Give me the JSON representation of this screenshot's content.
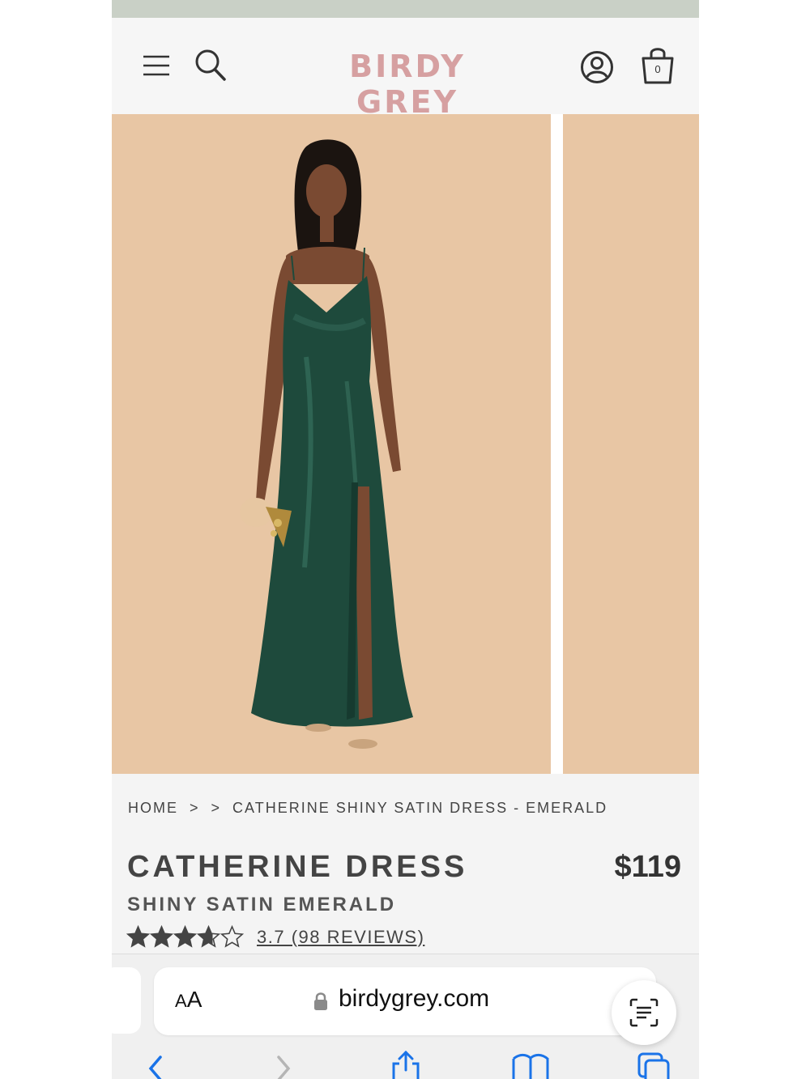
{
  "brand": {
    "logo_text": "BIRDY GREY",
    "logo_color": "#d6a0a1"
  },
  "header": {
    "bag_count": "0"
  },
  "breadcrumb": {
    "home": "HOME",
    "sep": ">",
    "current": "CATHERINE SHINY SATIN DRESS - EMERALD"
  },
  "product": {
    "title": "CATHERINE DRESS",
    "subtitle": "SHINY SATIN EMERALD",
    "price": "$119",
    "rating_value": 3.7,
    "rating_max": 5,
    "reviews_label": "3.7 (98 REVIEWS)",
    "dress_color": "#1e4a3c"
  },
  "browser": {
    "aa_label_small": "A",
    "aa_label_big": "A",
    "url": "birdygrey.com"
  },
  "icons": [
    "hamburger-menu-icon",
    "search-icon",
    "account-icon",
    "shopping-bag-icon",
    "lock-icon",
    "reader-icon",
    "back-icon",
    "forward-icon",
    "share-icon",
    "bookmarks-icon",
    "tabs-icon"
  ]
}
